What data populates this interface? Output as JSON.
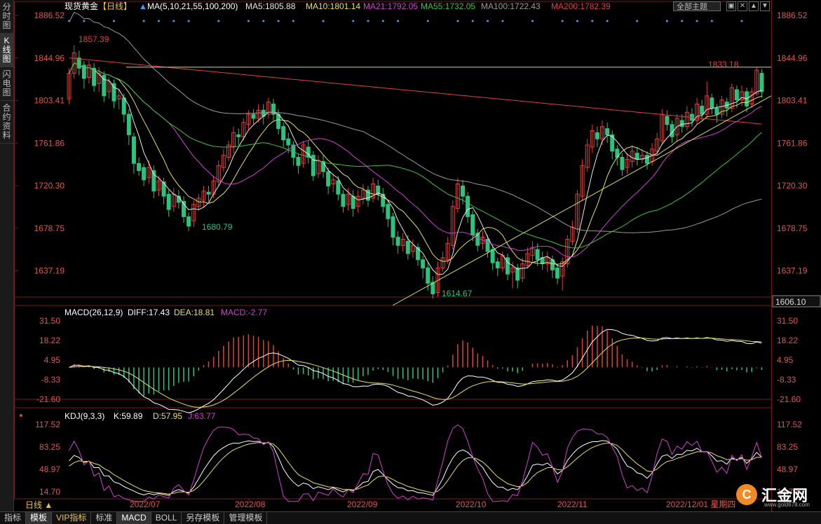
{
  "sidebar": {
    "tabs": [
      "分时图",
      "K线图",
      "闪电图",
      "合约资料"
    ],
    "active": 1
  },
  "header": {
    "symbol": "现货黄金",
    "period": "【日线】",
    "ma_label": "MA(5,10,21,55,100,200)",
    "ma_values": [
      {
        "text": "MA5:1805.88",
        "color": "#e8e8e8"
      },
      {
        "text": "MA10:1801.14",
        "color": "#e8e05a"
      },
      {
        "text": "MA21:1792.05",
        "color": "#d040d0"
      },
      {
        "text": "MA55:1732.05",
        "color": "#40c040"
      },
      {
        "text": "MA100:1722.43",
        "color": "#9a9a9a"
      },
      {
        "text": "MA200:1782.39",
        "color": "#e0403a"
      }
    ],
    "theme_select": "全部主题",
    "window_buttons": [
      "▣",
      "✕",
      "▲",
      "▼"
    ]
  },
  "price_axis": [
    "1886.52",
    "1844.96",
    "1803.41",
    "1761.86",
    "1720.30",
    "1678.75",
    "1637.19",
    "1606.10"
  ],
  "annotations": {
    "high": "1857.39",
    "low1": "1680.79",
    "low2": "1614.67",
    "recent_high": "1833.18"
  },
  "macd": {
    "title": "MACD(26,12,9)",
    "diff": "DIFF:17.43",
    "dea": "DEA:18.81",
    "macd": "MACD:-2.77",
    "axis": [
      "31.50",
      "18.22",
      "4.95",
      "-8.33",
      "-21.60"
    ]
  },
  "kdj": {
    "title": "KDJ(9,3,3)",
    "k": "K:59.89",
    "d": "D:57.95",
    "j": "J:63.77",
    "axis": [
      "117.52",
      "83.25",
      "48.97",
      "14.70"
    ]
  },
  "time_axis": [
    "2022/07",
    "2022/08",
    "2022/09",
    "2022/10",
    "2022/11"
  ],
  "cursor_label": "2022/12/01 星期四",
  "period_button": "日线 ▲",
  "toolbar_tabs": [
    "指标",
    "模板",
    "VIP指标",
    "标准",
    "MACD",
    "BOLL",
    "另存模板",
    "管理模板"
  ],
  "toolbar_active": [
    1,
    4
  ],
  "logo": {
    "text": "汇金网",
    "url": "www.gold678.com"
  },
  "colors": {
    "up": "#e0403a",
    "down": "#2ec27e",
    "bg": "#000000"
  },
  "chart_data": {
    "type": "candlestick",
    "note_range": "2022/06 - 2022/12/01 daily",
    "ylim": [
      1606.1,
      1886.52
    ],
    "candles": [
      [
        1805,
        1830,
        1800,
        1835
      ],
      [
        1830,
        1850,
        1825,
        1857.39
      ],
      [
        1845,
        1835,
        1828,
        1852
      ],
      [
        1838,
        1825,
        1815,
        1842
      ],
      [
        1826,
        1838,
        1820,
        1842
      ],
      [
        1835,
        1818,
        1812,
        1840
      ],
      [
        1820,
        1830,
        1812,
        1836
      ],
      [
        1828,
        1808,
        1802,
        1832
      ],
      [
        1812,
        1822,
        1805,
        1826
      ],
      [
        1820,
        1803,
        1796,
        1824
      ],
      [
        1805,
        1808,
        1795,
        1815
      ],
      [
        1806,
        1790,
        1782,
        1810
      ],
      [
        1790,
        1770,
        1760,
        1795
      ],
      [
        1768,
        1742,
        1732,
        1772
      ],
      [
        1742,
        1735,
        1730,
        1748
      ],
      [
        1738,
        1726,
        1720,
        1742
      ],
      [
        1728,
        1738,
        1722,
        1745
      ],
      [
        1735,
        1715,
        1708,
        1740
      ],
      [
        1716,
        1725,
        1710,
        1730
      ],
      [
        1724,
        1710,
        1702,
        1728
      ],
      [
        1712,
        1697,
        1690,
        1716
      ],
      [
        1700,
        1712,
        1695,
        1718
      ],
      [
        1710,
        1704,
        1698,
        1716
      ],
      [
        1705,
        1690,
        1684,
        1710
      ],
      [
        1690,
        1680.79,
        1676,
        1694
      ],
      [
        1686,
        1702,
        1680,
        1706
      ],
      [
        1700,
        1708,
        1696,
        1712
      ],
      [
        1706,
        1715,
        1700,
        1720
      ],
      [
        1714,
        1712,
        1705,
        1720
      ],
      [
        1712,
        1725,
        1708,
        1730
      ],
      [
        1724,
        1740,
        1720,
        1745
      ],
      [
        1738,
        1750,
        1734,
        1756
      ],
      [
        1748,
        1760,
        1744,
        1764
      ],
      [
        1758,
        1772,
        1752,
        1778
      ],
      [
        1770,
        1768,
        1760,
        1776
      ],
      [
        1768,
        1782,
        1764,
        1786
      ],
      [
        1780,
        1790,
        1775,
        1794
      ],
      [
        1790,
        1786,
        1780,
        1795
      ],
      [
        1786,
        1794,
        1782,
        1800
      ],
      [
        1794,
        1788,
        1780,
        1800
      ],
      [
        1790,
        1802,
        1786,
        1806
      ],
      [
        1800,
        1790,
        1784,
        1805
      ],
      [
        1790,
        1776,
        1770,
        1795
      ],
      [
        1778,
        1765,
        1758,
        1782
      ],
      [
        1766,
        1760,
        1752,
        1772
      ],
      [
        1760,
        1748,
        1740,
        1764
      ],
      [
        1748,
        1740,
        1732,
        1752
      ],
      [
        1742,
        1760,
        1738,
        1764
      ],
      [
        1758,
        1748,
        1742,
        1764
      ],
      [
        1750,
        1730,
        1725,
        1754
      ],
      [
        1732,
        1745,
        1728,
        1750
      ],
      [
        1744,
        1734,
        1728,
        1750
      ],
      [
        1734,
        1720,
        1712,
        1738
      ],
      [
        1722,
        1726,
        1714,
        1732
      ],
      [
        1725,
        1712,
        1706,
        1730
      ],
      [
        1712,
        1700,
        1694,
        1716
      ],
      [
        1702,
        1712,
        1696,
        1718
      ],
      [
        1710,
        1698,
        1690,
        1716
      ],
      [
        1700,
        1710,
        1694,
        1716
      ],
      [
        1708,
        1716,
        1702,
        1722
      ],
      [
        1716,
        1706,
        1700,
        1720
      ],
      [
        1708,
        1722,
        1704,
        1728
      ],
      [
        1720,
        1712,
        1706,
        1726
      ],
      [
        1712,
        1700,
        1694,
        1718
      ],
      [
        1702,
        1688,
        1680,
        1706
      ],
      [
        1690,
        1670,
        1662,
        1694
      ],
      [
        1670,
        1662,
        1654,
        1676
      ],
      [
        1662,
        1668,
        1656,
        1674
      ],
      [
        1666,
        1654,
        1648,
        1672
      ],
      [
        1656,
        1662,
        1650,
        1668
      ],
      [
        1660,
        1648,
        1642,
        1664
      ],
      [
        1648,
        1640,
        1630,
        1652
      ],
      [
        1640,
        1625,
        1618,
        1646
      ],
      [
        1626,
        1614.67,
        1610,
        1632
      ],
      [
        1616,
        1640,
        1612,
        1646
      ],
      [
        1640,
        1650,
        1636,
        1656
      ],
      [
        1648,
        1664,
        1644,
        1670
      ],
      [
        1662,
        1700,
        1658,
        1706
      ],
      [
        1698,
        1722,
        1694,
        1728
      ],
      [
        1720,
        1710,
        1702,
        1726
      ],
      [
        1710,
        1690,
        1684,
        1714
      ],
      [
        1692,
        1672,
        1666,
        1696
      ],
      [
        1674,
        1662,
        1656,
        1678
      ],
      [
        1664,
        1670,
        1658,
        1676
      ],
      [
        1668,
        1656,
        1650,
        1672
      ],
      [
        1658,
        1645,
        1638,
        1662
      ],
      [
        1646,
        1640,
        1632,
        1650
      ],
      [
        1640,
        1652,
        1636,
        1656
      ],
      [
        1650,
        1634,
        1628,
        1654
      ],
      [
        1636,
        1640,
        1620,
        1646
      ],
      [
        1640,
        1628,
        1620,
        1644
      ],
      [
        1630,
        1644,
        1626,
        1650
      ],
      [
        1642,
        1654,
        1640,
        1660
      ],
      [
        1652,
        1660,
        1646,
        1666
      ],
      [
        1658,
        1648,
        1642,
        1664
      ],
      [
        1650,
        1644,
        1638,
        1656
      ],
      [
        1644,
        1650,
        1636,
        1656
      ],
      [
        1648,
        1638,
        1630,
        1652
      ],
      [
        1640,
        1630,
        1624,
        1644
      ],
      [
        1632,
        1646,
        1618,
        1650
      ],
      [
        1644,
        1668,
        1640,
        1672
      ],
      [
        1666,
        1680,
        1662,
        1686
      ],
      [
        1678,
        1712,
        1674,
        1716
      ],
      [
        1710,
        1740,
        1706,
        1746
      ],
      [
        1738,
        1760,
        1734,
        1766
      ],
      [
        1758,
        1774,
        1752,
        1780
      ],
      [
        1772,
        1766,
        1758,
        1778
      ],
      [
        1766,
        1778,
        1760,
        1784
      ],
      [
        1776,
        1770,
        1762,
        1782
      ],
      [
        1770,
        1754,
        1746,
        1774
      ],
      [
        1756,
        1748,
        1740,
        1760
      ],
      [
        1748,
        1736,
        1730,
        1752
      ],
      [
        1738,
        1746,
        1732,
        1752
      ],
      [
        1744,
        1754,
        1738,
        1760
      ],
      [
        1752,
        1746,
        1740,
        1758
      ],
      [
        1746,
        1750,
        1742,
        1756
      ],
      [
        1750,
        1742,
        1736,
        1754
      ],
      [
        1744,
        1756,
        1740,
        1762
      ],
      [
        1754,
        1766,
        1750,
        1772
      ],
      [
        1764,
        1790,
        1760,
        1795
      ],
      [
        1788,
        1780,
        1774,
        1794
      ],
      [
        1780,
        1768,
        1762,
        1784
      ],
      [
        1770,
        1786,
        1764,
        1790
      ],
      [
        1784,
        1778,
        1772,
        1790
      ],
      [
        1778,
        1792,
        1774,
        1798
      ],
      [
        1790,
        1784,
        1778,
        1796
      ],
      [
        1784,
        1800,
        1780,
        1806
      ],
      [
        1798,
        1790,
        1784,
        1804
      ],
      [
        1790,
        1808,
        1786,
        1822
      ],
      [
        1806,
        1796,
        1790,
        1810
      ],
      [
        1796,
        1790,
        1782,
        1800
      ],
      [
        1790,
        1804,
        1786,
        1808
      ],
      [
        1802,
        1796,
        1788,
        1806
      ],
      [
        1796,
        1816,
        1792,
        1820
      ],
      [
        1814,
        1804,
        1796,
        1818
      ],
      [
        1804,
        1812,
        1798,
        1818
      ],
      [
        1812,
        1798,
        1792,
        1816
      ],
      [
        1800,
        1812,
        1796,
        1816
      ],
      [
        1810,
        1833.18,
        1808,
        1836
      ],
      [
        1830,
        1812,
        1806,
        1834
      ]
    ]
  }
}
